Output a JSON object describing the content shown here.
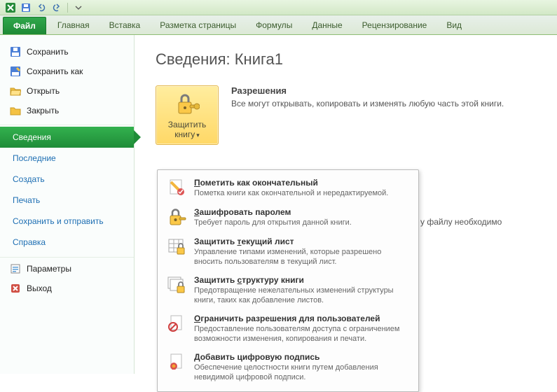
{
  "titlebar": {
    "app_icon": "X",
    "qat": [
      "undo-icon",
      "redo-icon",
      "separator",
      "dropdown-icon"
    ]
  },
  "ribbon": {
    "file": "Файл",
    "tabs": [
      "Главная",
      "Вставка",
      "Разметка страницы",
      "Формулы",
      "Данные",
      "Рецензирование",
      "Вид"
    ]
  },
  "sidebar": {
    "top": [
      {
        "icon": "save",
        "label": "Сохранить"
      },
      {
        "icon": "saveas",
        "label": "Сохранить как"
      },
      {
        "icon": "open",
        "label": "Открыть"
      },
      {
        "icon": "close",
        "label": "Закрыть"
      }
    ],
    "links": [
      {
        "label": "Сведения",
        "selected": true
      },
      {
        "label": "Последние"
      },
      {
        "label": "Создать"
      },
      {
        "label": "Печать"
      },
      {
        "label": "Сохранить и отправить"
      },
      {
        "label": "Справка"
      }
    ],
    "bottom": [
      {
        "icon": "options",
        "label": "Параметры"
      },
      {
        "icon": "exit",
        "label": "Выход"
      }
    ]
  },
  "page": {
    "title": "Сведения: Книга1",
    "protect_button": "Защитить книгу",
    "permissions_heading": "Разрешения",
    "permissions_text": "Все могут открывать, копировать и изменять любую часть этой книги.",
    "behind_text": "у файлу необходимо"
  },
  "dropdown": [
    {
      "icon": "final",
      "title_pre": "",
      "title_u": "П",
      "title_post": "ометить как окончательный",
      "desc": "Пометка книги как окончательной и нередактируемой."
    },
    {
      "icon": "encrypt",
      "title_pre": "",
      "title_u": "З",
      "title_post": "ашифровать паролем",
      "desc": "Требует пароль для открытия данной книги."
    },
    {
      "icon": "sheet",
      "title_pre": "Защитить ",
      "title_u": "т",
      "title_post": "екущий лист",
      "desc": "Управление типами изменений, которые разрешено вносить пользователям в текущий лист."
    },
    {
      "icon": "struct",
      "title_pre": "Защитить ",
      "title_u": "с",
      "title_post": "труктуру книги",
      "desc": "Предотвращение нежелательных изменений структуры книги, таких как добавление листов."
    },
    {
      "icon": "restrict",
      "title_pre": "",
      "title_u": "О",
      "title_post": "граничить разрешения для пользователей",
      "desc": "Предоставление пользователям доступа с ограничением возможности изменения, копирования и печати."
    },
    {
      "icon": "sign",
      "title_pre": "",
      "title_u": "Д",
      "title_post": "обавить цифровую подпись",
      "desc": "Обеспечение целостности книги путем добавления невидимой цифровой подписи."
    }
  ]
}
